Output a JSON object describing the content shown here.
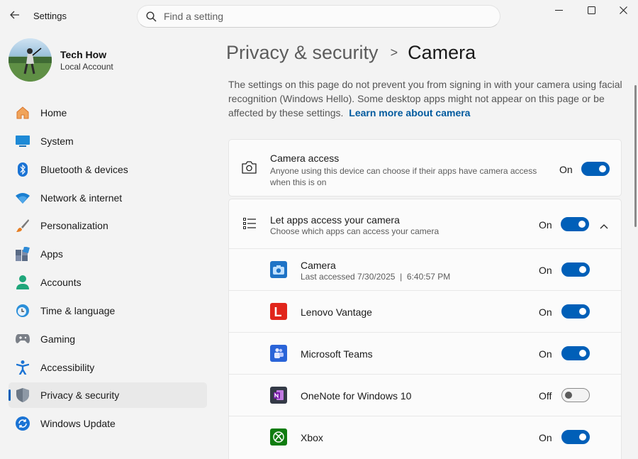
{
  "window": {
    "title": "Settings",
    "back_icon": "back-arrow-icon",
    "controls": [
      "minimize-icon",
      "maximize-icon",
      "close-icon"
    ]
  },
  "search": {
    "placeholder": "Find a setting",
    "value": ""
  },
  "profile": {
    "name": "Tech How",
    "account": "Local Account"
  },
  "sidebar": {
    "items": [
      {
        "label": "Home",
        "icon": "home-icon"
      },
      {
        "label": "System",
        "icon": "system-icon"
      },
      {
        "label": "Bluetooth & devices",
        "icon": "bluetooth-icon"
      },
      {
        "label": "Network & internet",
        "icon": "wifi-icon"
      },
      {
        "label": "Personalization",
        "icon": "brush-icon"
      },
      {
        "label": "Apps",
        "icon": "apps-icon"
      },
      {
        "label": "Accounts",
        "icon": "accounts-icon"
      },
      {
        "label": "Time & language",
        "icon": "clock-globe-icon"
      },
      {
        "label": "Gaming",
        "icon": "gamepad-icon"
      },
      {
        "label": "Accessibility",
        "icon": "accessibility-icon"
      },
      {
        "label": "Privacy & security",
        "icon": "shield-icon",
        "selected": true
      },
      {
        "label": "Windows Update",
        "icon": "update-icon"
      }
    ]
  },
  "breadcrumb": {
    "parent": "Privacy & security",
    "separator": ">",
    "current": "Camera"
  },
  "description": {
    "text": "The settings on this page do not prevent you from signing in with your camera using facial recognition (Windows Hello). Some desktop apps might not appear on this page or be affected by these settings.",
    "link": "Learn more about camera"
  },
  "camera_access": {
    "title": "Camera access",
    "subtitle": "Anyone using this device can choose if their apps have camera access when this is on",
    "state": "On",
    "icon": "camera-icon"
  },
  "apps_access": {
    "title": "Let apps access your camera",
    "subtitle": "Choose which apps can access your camera",
    "state": "On",
    "icon": "list-icon",
    "expand_icon": "chevron-up-icon"
  },
  "apps": [
    {
      "name": "Camera",
      "detail": "Last accessed 7/30/2025  |  6:40:57 PM",
      "state": "On",
      "icon": "camera-app-icon",
      "color": "#1e73c6"
    },
    {
      "name": "Lenovo Vantage",
      "detail": "",
      "state": "On",
      "icon": "lenovo-vantage-icon",
      "color": "#e1251b"
    },
    {
      "name": "Microsoft Teams",
      "detail": "",
      "state": "On",
      "icon": "teams-icon",
      "color": "#2a64d8"
    },
    {
      "name": "OneNote for Windows 10",
      "detail": "",
      "state": "Off",
      "icon": "onenote-icon",
      "color": "#343a47"
    },
    {
      "name": "Xbox",
      "detail": "",
      "state": "On",
      "icon": "xbox-icon",
      "color": "#107c10"
    }
  ],
  "colors": {
    "accent": "#005fb8",
    "link": "#005a9e",
    "background": "#f3f3f3"
  }
}
